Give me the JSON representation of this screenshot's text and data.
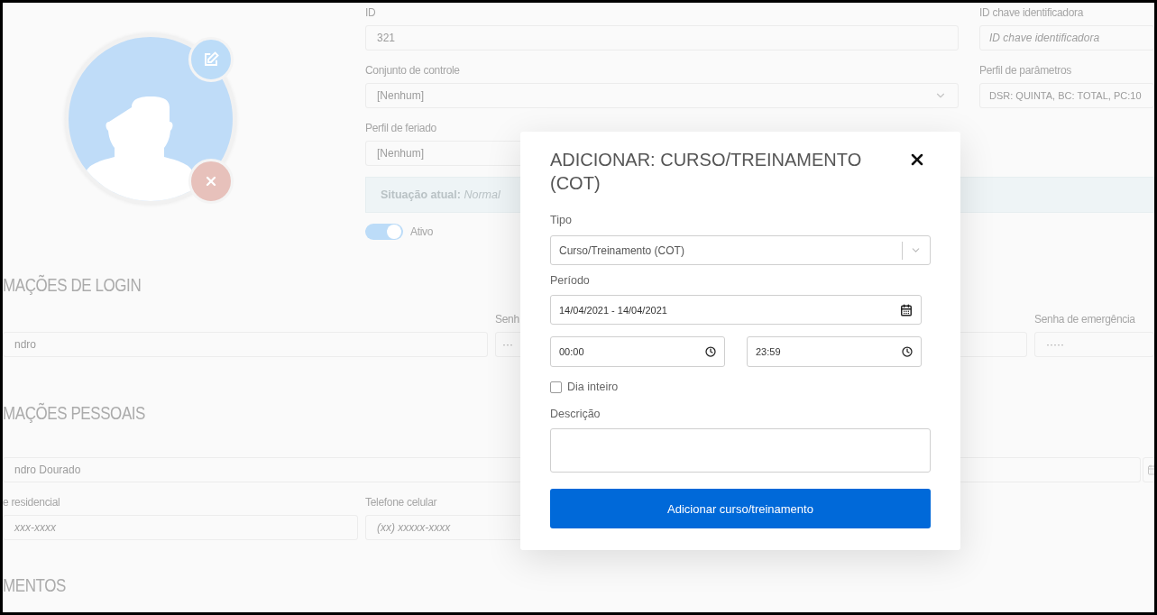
{
  "profile": {
    "kind": "avatar"
  },
  "identity": {
    "fields": [
      {
        "label": "ID",
        "value": "321",
        "kind": "input"
      },
      {
        "label": "Conjunto de controle",
        "value": "[Nenhum]",
        "kind": "select"
      },
      {
        "label": "Perfil de feriado",
        "value": "[Nenhum]",
        "kind": "input"
      }
    ],
    "side_fields": [
      {
        "label": "ID chave identificadora",
        "placeholder": "ID chave identificadora"
      },
      {
        "label": "Perfil de parâmetros",
        "value": "DSR: QUINTA, BC: TOTAL, PC:10"
      }
    ],
    "status": {
      "label": "Situação atual:",
      "value": "Normal"
    },
    "active": {
      "label": "Ativo",
      "on": true
    }
  },
  "login": {
    "title": "MAÇÕES DE LOGIN",
    "fields": [
      {
        "value": "ndro"
      },
      {
        "label": "Senh",
        "value": "···"
      },
      {
        "label": "Senha de emergência",
        "value": "·····"
      }
    ]
  },
  "personal": {
    "title": "MAÇÕES PESSOAIS",
    "name": {
      "value": "ndro Dourado"
    },
    "phones": [
      {
        "label": "e residencial",
        "placeholder": "xxx-xxxx"
      },
      {
        "label": "Telefone celular",
        "placeholder": "(xx) xxxxx-xxxx"
      }
    ]
  },
  "documents": {
    "title": "MENTOS"
  },
  "modal": {
    "title": "ADICIONAR: CURSO/TREINAMENTO (COT)",
    "type": {
      "label": "Tipo",
      "value": "Curso/Treinamento (COT)"
    },
    "period": {
      "label": "Período",
      "value": "14/04/2021 - 14/04/2021"
    },
    "times": [
      {
        "value": "00:00"
      },
      {
        "value": "23:59"
      }
    ],
    "all_day": {
      "label": "Dia inteiro",
      "checked": false
    },
    "description": {
      "label": "Descrição"
    },
    "submit": "Adicionar curso/treinamento"
  }
}
